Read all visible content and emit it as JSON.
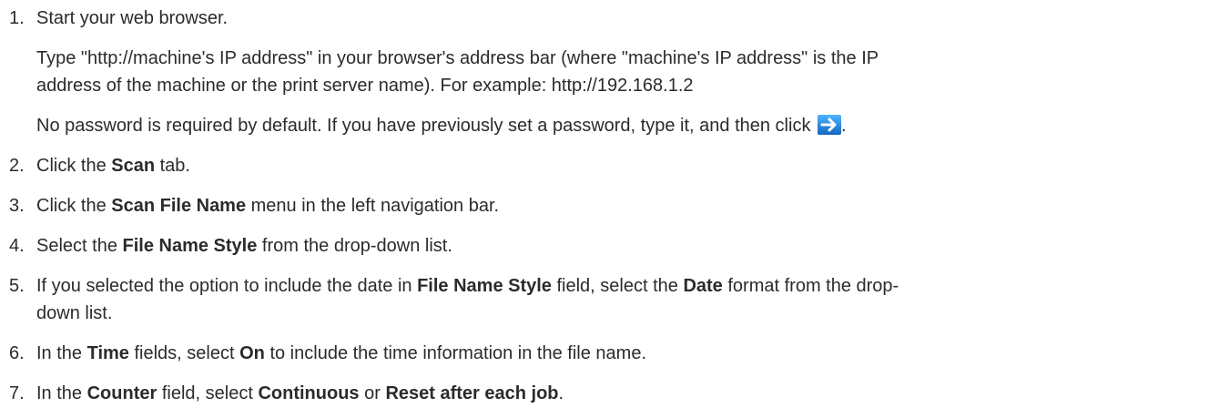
{
  "steps": [
    {
      "number": "1.",
      "text": "Start your web browser.",
      "paragraphs": [
        {
          "line1": "Type \"http://machine's IP address\" in your browser's address bar (where \"machine's IP address\" is the IP",
          "line2": "address of the machine or the print server name). For example: http://192.168.1.2"
        },
        {
          "text_before_icon": "No password is required by default. If you have previously set a password, type it, and then click ",
          "icon": "blue-arrow-right-icon",
          "text_after_icon": "."
        }
      ]
    },
    {
      "number": "2.",
      "pre": "Click the ",
      "bold": "Scan",
      "post": " tab."
    },
    {
      "number": "3.",
      "pre": "Click the ",
      "bold": "Scan File Name",
      "post": " menu in the left navigation bar."
    },
    {
      "number": "4.",
      "pre": "Select the ",
      "bold": "File Name Style",
      "post": " from the drop-down list."
    },
    {
      "number": "5.",
      "pre": "If you selected the option to include the date in ",
      "bold1": "File Name Style",
      "mid": " field, select the ",
      "bold2": "Date",
      "post": " format from the drop-",
      "line2": "down list."
    },
    {
      "number": "6.",
      "pre": "In the ",
      "bold1": "Time",
      "mid": " fields, select ",
      "bold2": "On",
      "post": " to include the time information in the file name."
    },
    {
      "number": "7.",
      "pre": "In the ",
      "bold1": "Counter",
      "mid1": " field, select ",
      "bold2": "Continuous",
      "mid2": " or ",
      "bold3": "Reset after each job",
      "post": "."
    }
  ],
  "colors": {
    "text": "#2b2b2b",
    "icon_blue": "#1e88e5"
  }
}
